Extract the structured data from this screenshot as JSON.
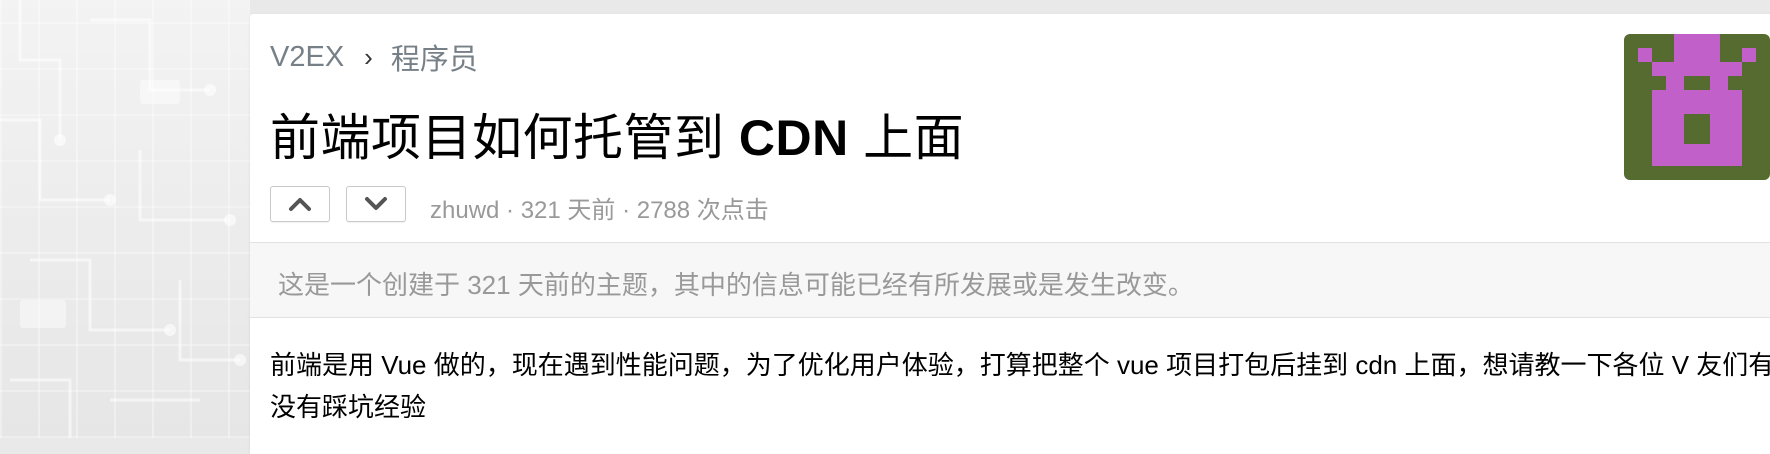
{
  "breadcrumb": {
    "site": "V2EX",
    "separator": "›",
    "node": "程序员"
  },
  "topic": {
    "title_part1": "前端项目如何托管到 ",
    "title_bold": "CDN",
    "title_part2": " 上面",
    "author": "zhuwd",
    "meta_rest": " · 321 天前 · 2788 次点击"
  },
  "notice": "这是一个创建于 321 天前的主题，其中的信息可能已经有所发展或是发生改变。",
  "content": "前端是用 Vue 做的，现在遇到性能问题，为了优化用户体验，打算把整个 vue 项目打包后挂到 cdn 上面，想请教一下各位 V 友们有没有踩坑经验",
  "icons": {
    "upvote": "chevron-up-icon",
    "downvote": "chevron-down-icon"
  },
  "colors": {
    "avatar_bg": "#556b2f",
    "avatar_fg": "#c060c8",
    "muted_text": "#999999",
    "breadcrumb_text": "#778087"
  }
}
